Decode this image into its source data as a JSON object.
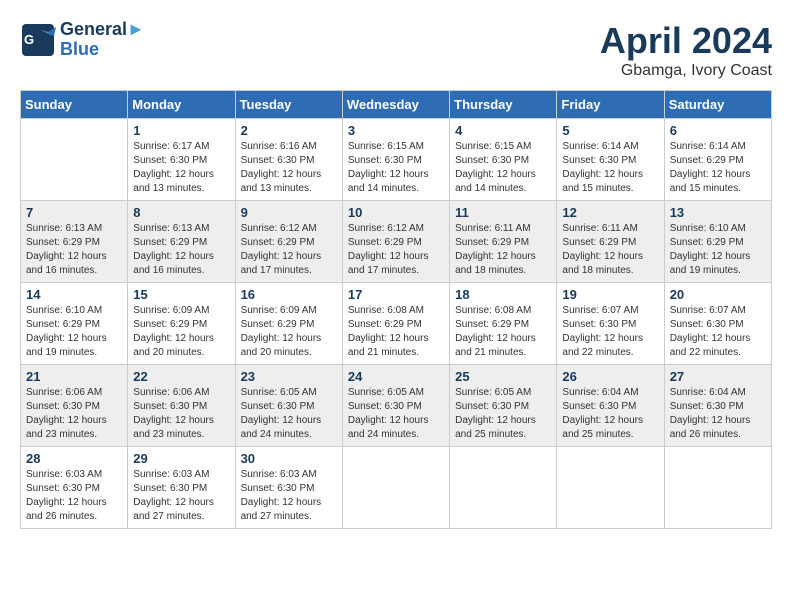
{
  "header": {
    "logo_line1": "General",
    "logo_line2": "Blue",
    "month": "April 2024",
    "location": "Gbamga, Ivory Coast"
  },
  "days_of_week": [
    "Sunday",
    "Monday",
    "Tuesday",
    "Wednesday",
    "Thursday",
    "Friday",
    "Saturday"
  ],
  "weeks": [
    [
      {
        "day": "",
        "info": ""
      },
      {
        "day": "1",
        "info": "Sunrise: 6:17 AM\nSunset: 6:30 PM\nDaylight: 12 hours\nand 13 minutes."
      },
      {
        "day": "2",
        "info": "Sunrise: 6:16 AM\nSunset: 6:30 PM\nDaylight: 12 hours\nand 13 minutes."
      },
      {
        "day": "3",
        "info": "Sunrise: 6:15 AM\nSunset: 6:30 PM\nDaylight: 12 hours\nand 14 minutes."
      },
      {
        "day": "4",
        "info": "Sunrise: 6:15 AM\nSunset: 6:30 PM\nDaylight: 12 hours\nand 14 minutes."
      },
      {
        "day": "5",
        "info": "Sunrise: 6:14 AM\nSunset: 6:30 PM\nDaylight: 12 hours\nand 15 minutes."
      },
      {
        "day": "6",
        "info": "Sunrise: 6:14 AM\nSunset: 6:29 PM\nDaylight: 12 hours\nand 15 minutes."
      }
    ],
    [
      {
        "day": "7",
        "info": "Sunrise: 6:13 AM\nSunset: 6:29 PM\nDaylight: 12 hours\nand 16 minutes."
      },
      {
        "day": "8",
        "info": "Sunrise: 6:13 AM\nSunset: 6:29 PM\nDaylight: 12 hours\nand 16 minutes."
      },
      {
        "day": "9",
        "info": "Sunrise: 6:12 AM\nSunset: 6:29 PM\nDaylight: 12 hours\nand 17 minutes."
      },
      {
        "day": "10",
        "info": "Sunrise: 6:12 AM\nSunset: 6:29 PM\nDaylight: 12 hours\nand 17 minutes."
      },
      {
        "day": "11",
        "info": "Sunrise: 6:11 AM\nSunset: 6:29 PM\nDaylight: 12 hours\nand 18 minutes."
      },
      {
        "day": "12",
        "info": "Sunrise: 6:11 AM\nSunset: 6:29 PM\nDaylight: 12 hours\nand 18 minutes."
      },
      {
        "day": "13",
        "info": "Sunrise: 6:10 AM\nSunset: 6:29 PM\nDaylight: 12 hours\nand 19 minutes."
      }
    ],
    [
      {
        "day": "14",
        "info": "Sunrise: 6:10 AM\nSunset: 6:29 PM\nDaylight: 12 hours\nand 19 minutes."
      },
      {
        "day": "15",
        "info": "Sunrise: 6:09 AM\nSunset: 6:29 PM\nDaylight: 12 hours\nand 20 minutes."
      },
      {
        "day": "16",
        "info": "Sunrise: 6:09 AM\nSunset: 6:29 PM\nDaylight: 12 hours\nand 20 minutes."
      },
      {
        "day": "17",
        "info": "Sunrise: 6:08 AM\nSunset: 6:29 PM\nDaylight: 12 hours\nand 21 minutes."
      },
      {
        "day": "18",
        "info": "Sunrise: 6:08 AM\nSunset: 6:29 PM\nDaylight: 12 hours\nand 21 minutes."
      },
      {
        "day": "19",
        "info": "Sunrise: 6:07 AM\nSunset: 6:30 PM\nDaylight: 12 hours\nand 22 minutes."
      },
      {
        "day": "20",
        "info": "Sunrise: 6:07 AM\nSunset: 6:30 PM\nDaylight: 12 hours\nand 22 minutes."
      }
    ],
    [
      {
        "day": "21",
        "info": "Sunrise: 6:06 AM\nSunset: 6:30 PM\nDaylight: 12 hours\nand 23 minutes."
      },
      {
        "day": "22",
        "info": "Sunrise: 6:06 AM\nSunset: 6:30 PM\nDaylight: 12 hours\nand 23 minutes."
      },
      {
        "day": "23",
        "info": "Sunrise: 6:05 AM\nSunset: 6:30 PM\nDaylight: 12 hours\nand 24 minutes."
      },
      {
        "day": "24",
        "info": "Sunrise: 6:05 AM\nSunset: 6:30 PM\nDaylight: 12 hours\nand 24 minutes."
      },
      {
        "day": "25",
        "info": "Sunrise: 6:05 AM\nSunset: 6:30 PM\nDaylight: 12 hours\nand 25 minutes."
      },
      {
        "day": "26",
        "info": "Sunrise: 6:04 AM\nSunset: 6:30 PM\nDaylight: 12 hours\nand 25 minutes."
      },
      {
        "day": "27",
        "info": "Sunrise: 6:04 AM\nSunset: 6:30 PM\nDaylight: 12 hours\nand 26 minutes."
      }
    ],
    [
      {
        "day": "28",
        "info": "Sunrise: 6:03 AM\nSunset: 6:30 PM\nDaylight: 12 hours\nand 26 minutes."
      },
      {
        "day": "29",
        "info": "Sunrise: 6:03 AM\nSunset: 6:30 PM\nDaylight: 12 hours\nand 27 minutes."
      },
      {
        "day": "30",
        "info": "Sunrise: 6:03 AM\nSunset: 6:30 PM\nDaylight: 12 hours\nand 27 minutes."
      },
      {
        "day": "",
        "info": ""
      },
      {
        "day": "",
        "info": ""
      },
      {
        "day": "",
        "info": ""
      },
      {
        "day": "",
        "info": ""
      }
    ]
  ]
}
